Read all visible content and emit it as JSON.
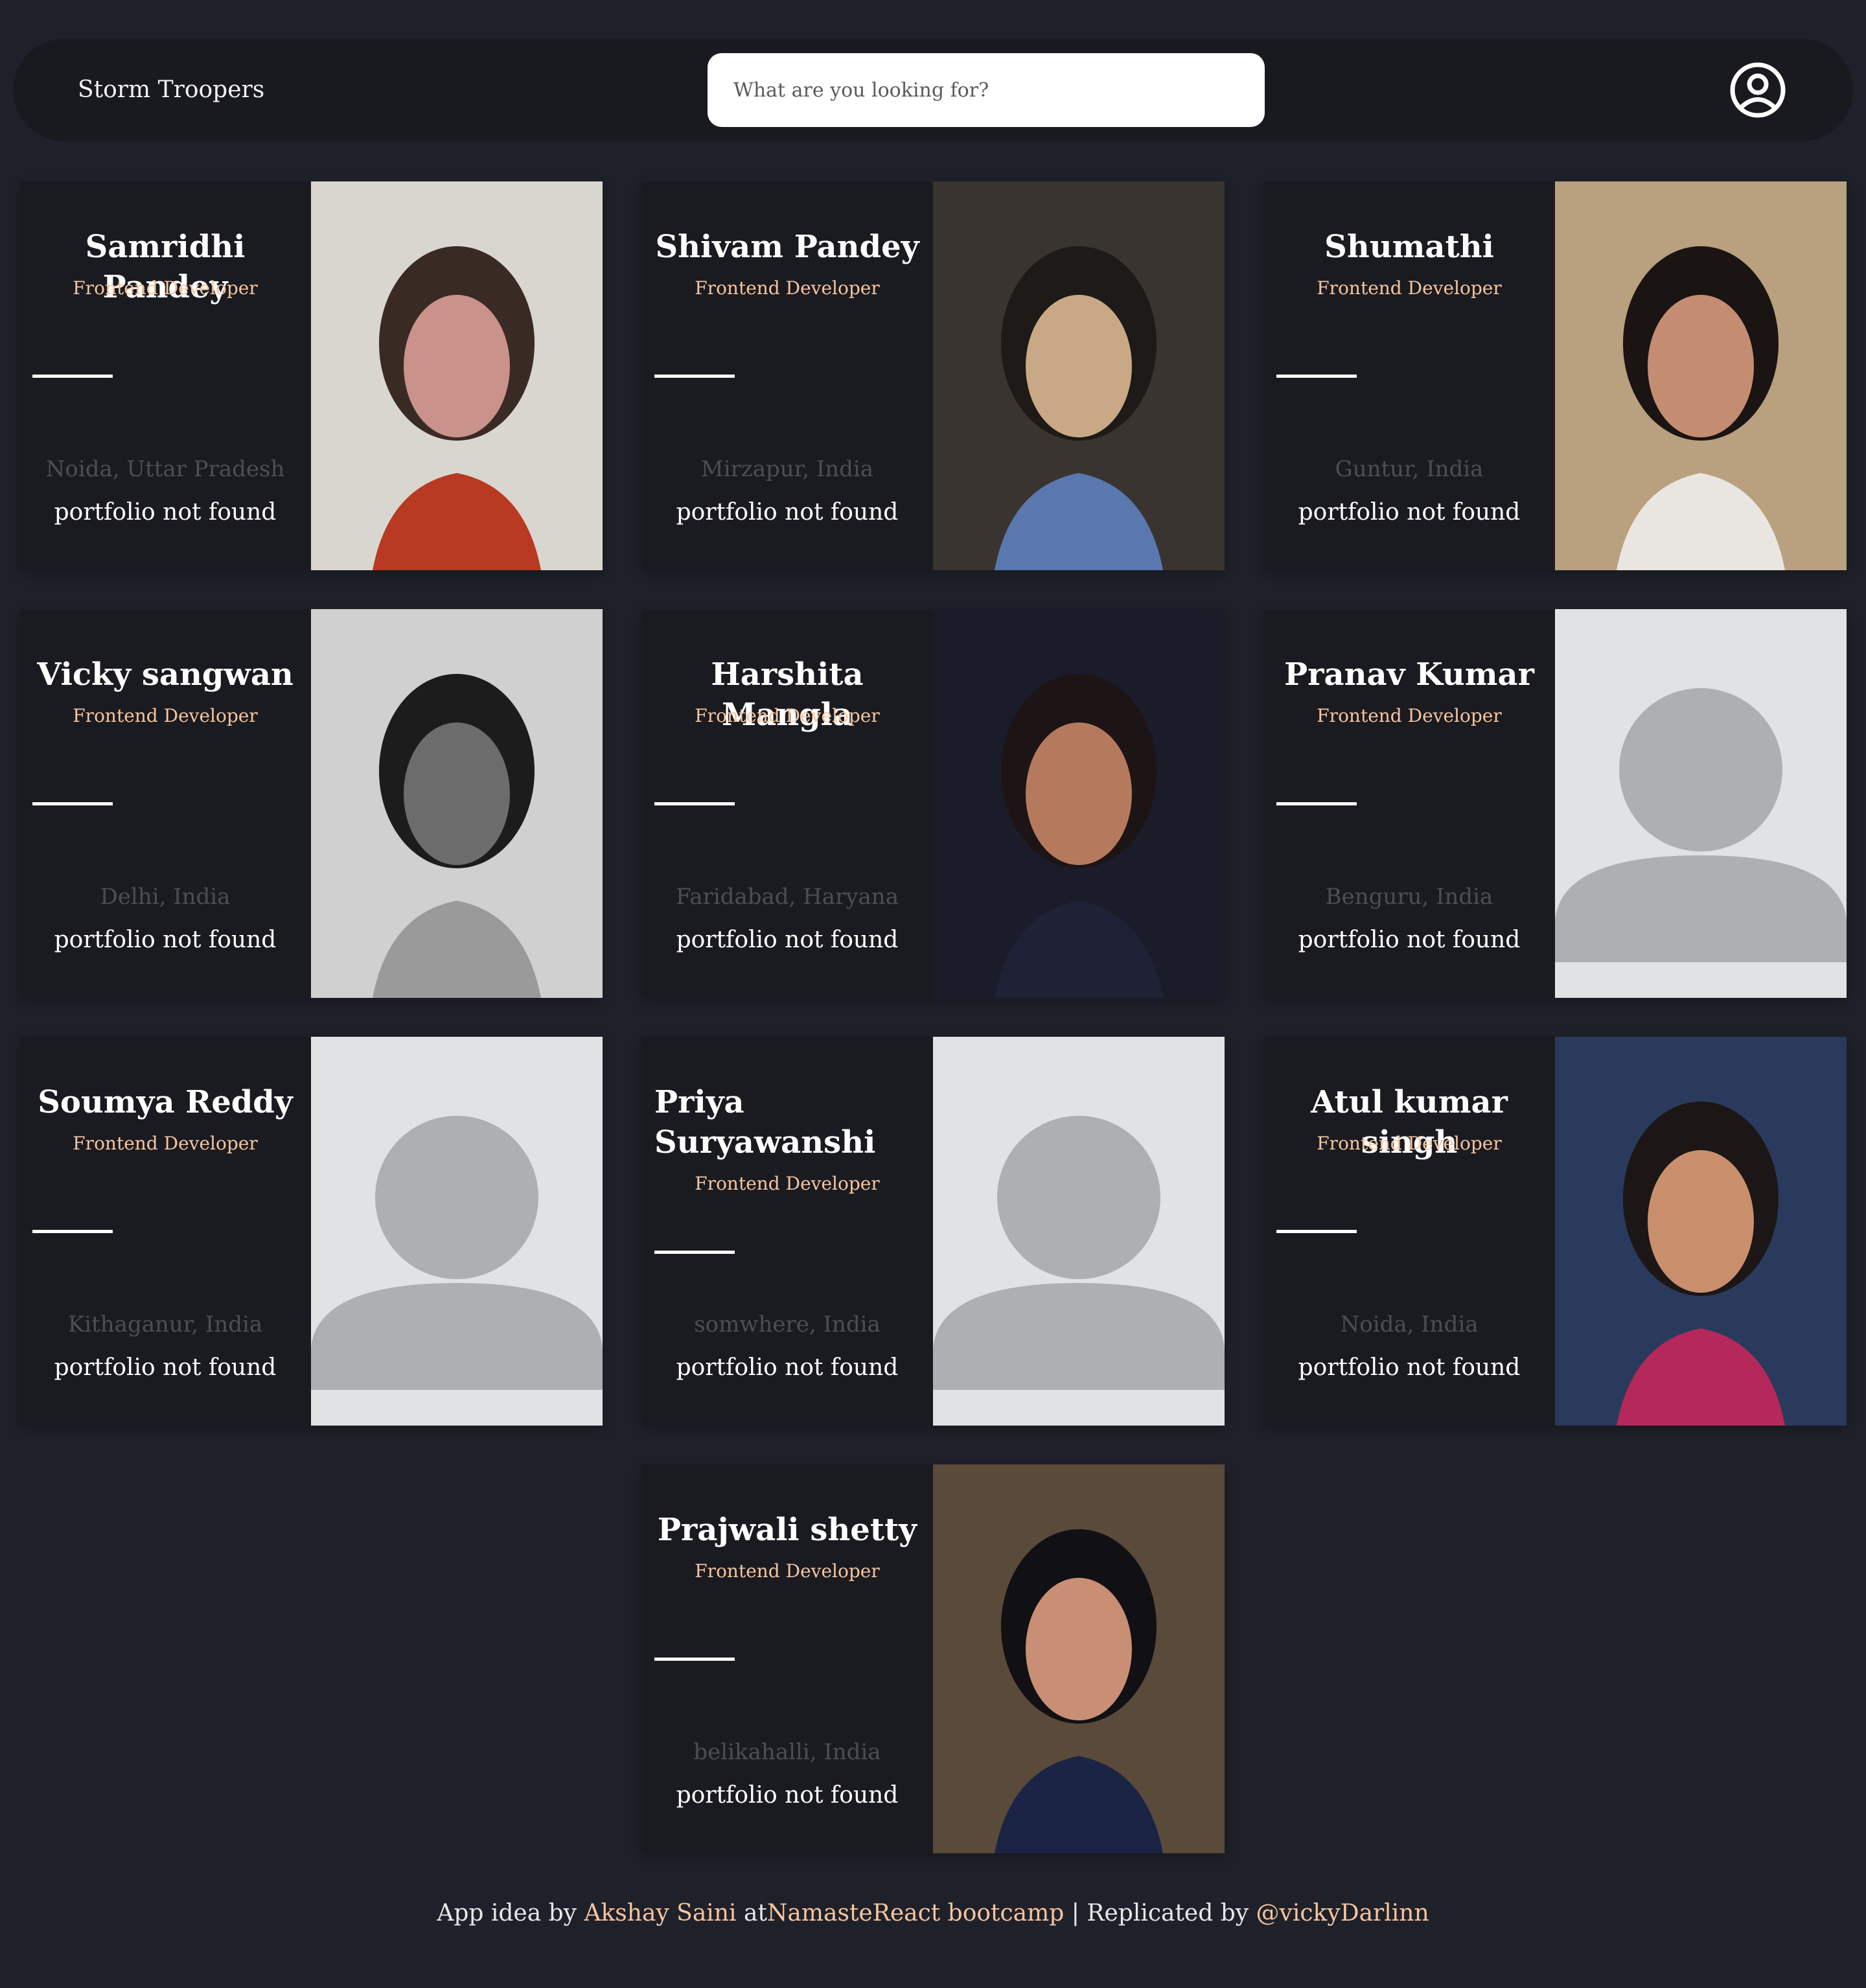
{
  "header": {
    "brand": "Storm Troopers",
    "search_placeholder": "What are you looking for?",
    "user_icon": "user-circle-icon"
  },
  "cards": [
    {
      "name": "Samridhi Pandey",
      "role": "Frontend Developer",
      "location": "Noida, Uttar Pradesh",
      "portfolio": "portfolio not found",
      "photo": "photo"
    },
    {
      "name": "Shivam Pandey",
      "role": "Frontend Developer",
      "location": "Mirzapur, India",
      "portfolio": "portfolio not found",
      "photo": "photo"
    },
    {
      "name": "Shumathi",
      "role": "Frontend Developer",
      "location": "Guntur, India",
      "portfolio": "portfolio not found",
      "photo": "photo"
    },
    {
      "name": "Vicky sangwan",
      "role": "Frontend Developer",
      "location": "Delhi, India",
      "portfolio": "portfolio not found",
      "photo": "photo"
    },
    {
      "name": "Harshita Mangla",
      "role": "Frontend Developer",
      "location": "Faridabad, Haryana",
      "portfolio": "portfolio not found",
      "photo": "photo"
    },
    {
      "name": "Pranav Kumar",
      "role": "Frontend Developer",
      "location": "Benguru, India",
      "portfolio": "portfolio not found",
      "photo": "placeholder"
    },
    {
      "name": "Soumya Reddy",
      "role": "Frontend Developer",
      "location": "Kithaganur, India",
      "portfolio": "portfolio not found",
      "photo": "placeholder"
    },
    {
      "name": "Priya Suryawanshi",
      "role": "Frontend Developer",
      "location": "somwhere, India",
      "portfolio": "portfolio not found",
      "photo": "placeholder"
    },
    {
      "name": "Atul kumar singh",
      "role": "Frontend Developer",
      "location": "Noida, India",
      "portfolio": "portfolio not found",
      "photo": "photo"
    },
    {
      "name": "Prajwali shetty",
      "role": "Frontend Developer",
      "location": "belikahalli, India",
      "portfolio": "portfolio not found",
      "photo": "photo"
    }
  ],
  "footer": {
    "prefix": "App idea by ",
    "author_link": "Akshay Saini",
    "at_text": " at",
    "bootcamp_link": "NamasteReact bootcamp",
    "separator": " | Replicated by ",
    "replicator_link": "@vickyDarlinn"
  },
  "colors": {
    "background": "#1f212a",
    "card": "#1a1b21",
    "accent": "#f7c59f",
    "muted": "#4d4e55"
  }
}
